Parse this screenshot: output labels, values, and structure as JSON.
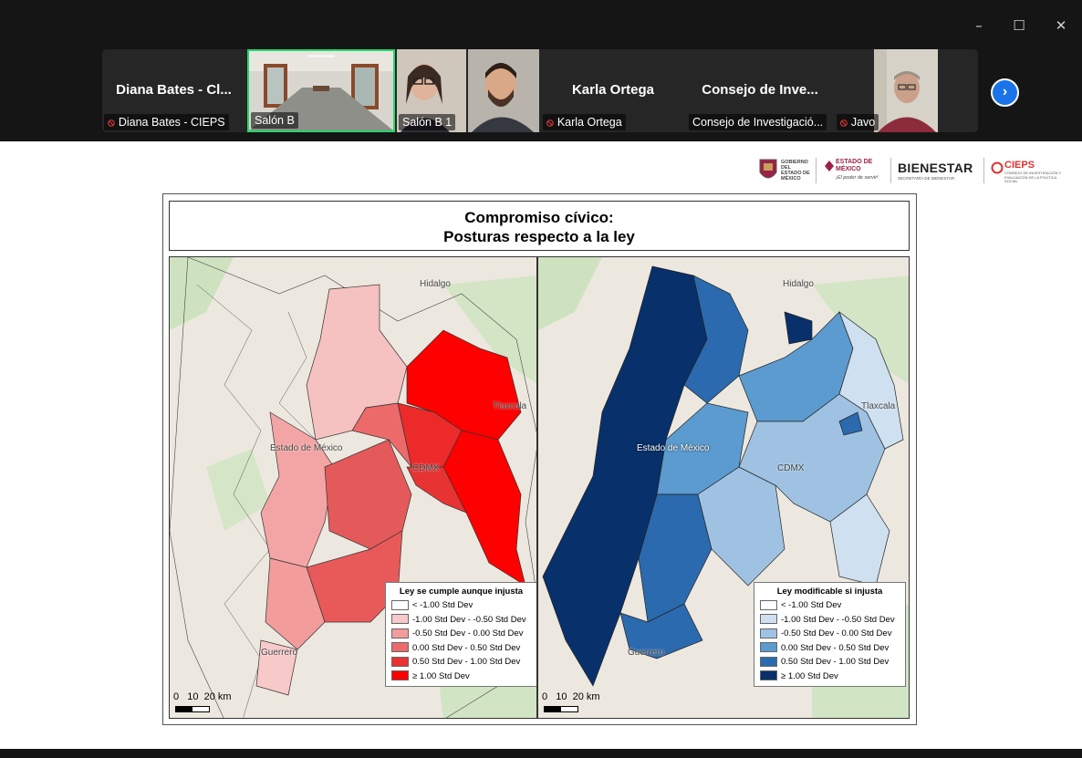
{
  "window": {
    "controls": {
      "minimize": "–",
      "maximize": "☐",
      "close": "✕"
    }
  },
  "participants": [
    {
      "big_name": "Diana Bates - Cl...",
      "tag": "Diana Bates - CIEPS",
      "muted": true
    },
    {
      "big_name": "",
      "tag": "Salón B",
      "muted": false,
      "active_speaker": true
    },
    {
      "big_name": "",
      "tag": "Salón B 1",
      "muted": false
    },
    {
      "big_name": "Karla Ortega",
      "tag": "Karla Ortega",
      "muted": true
    },
    {
      "big_name": "Consejo de Inve...",
      "tag": "Consejo de Investigació...",
      "muted": false
    },
    {
      "big_name": "",
      "tag": "Javo",
      "muted": true
    }
  ],
  "icons": {
    "mic_muted": "mic-off-icon",
    "next": "chevron-right-icon"
  },
  "slide": {
    "logos": {
      "gobierno": "GOBIERNO DEL ESTADO DE MÉXICO",
      "estado": "ESTADO DE MÉXICO",
      "estado_slogan": "¡El poder de servir!",
      "bienestar": "BIENESTAR",
      "bienestar_sub": "SECRETARÍA DE BIENESTAR",
      "cieps": "CIEPS",
      "cieps_sub": "CONSEJO DE INVESTIGACIÓN Y EVALUACIÓN DE LA POLÍTICA SOCIAL"
    },
    "title_line1": "Compromiso cívico:",
    "title_line2": "Posturas respecto a la ley",
    "maps": [
      {
        "legend_title": "Ley se cumple aunque injusta",
        "legend": [
          {
            "label": "<  -1.00 Std Dev",
            "color": "#ffffff"
          },
          {
            "label": "-1.00 Std Dev -  -0.50 Std Dev",
            "color": "#f8c9c9"
          },
          {
            "label": "-0.50 Std Dev -  0.00 Std Dev",
            "color": "#f29c9c"
          },
          {
            "label": "0.00 Std Dev -  0.50 Std Dev",
            "color": "#ec6a6a"
          },
          {
            "label": "0.50 Std Dev -  1.00 Std Dev",
            "color": "#e83333"
          },
          {
            "label": "≥  1.00 Std Dev",
            "color": "#ff0000"
          }
        ],
        "places": {
          "hidalgo": "Hidalgo",
          "tlaxcala": "Tlaxcala",
          "edomex": "Estado de México",
          "cdmx": "CDMX",
          "guerrero": "Guerrero"
        },
        "scale": "0   10  20 km"
      },
      {
        "legend_title": "Ley modificable si injusta",
        "legend": [
          {
            "label": "<  -1.00 Std Dev",
            "color": "#ffffff"
          },
          {
            "label": "-1.00 Std Dev -  -0.50 Std Dev",
            "color": "#cfe0f0"
          },
          {
            "label": "-0.50 Std Dev -  0.00 Std Dev",
            "color": "#9fc2e2"
          },
          {
            "label": "0.00 Std Dev -  0.50 Std Dev",
            "color": "#5b9bcf"
          },
          {
            "label": "0.50 Std Dev -  1.00 Std Dev",
            "color": "#2b6aae"
          },
          {
            "label": "≥  1.00 Std Dev",
            "color": "#08306b"
          }
        ],
        "places": {
          "hidalgo": "Hidalgo",
          "tlaxcala": "Tlaxcala",
          "edomex": "Estado de México",
          "cdmx": "CDMX",
          "guerrero": "Guerrero"
        },
        "scale": "0   10  20 km"
      }
    ]
  }
}
